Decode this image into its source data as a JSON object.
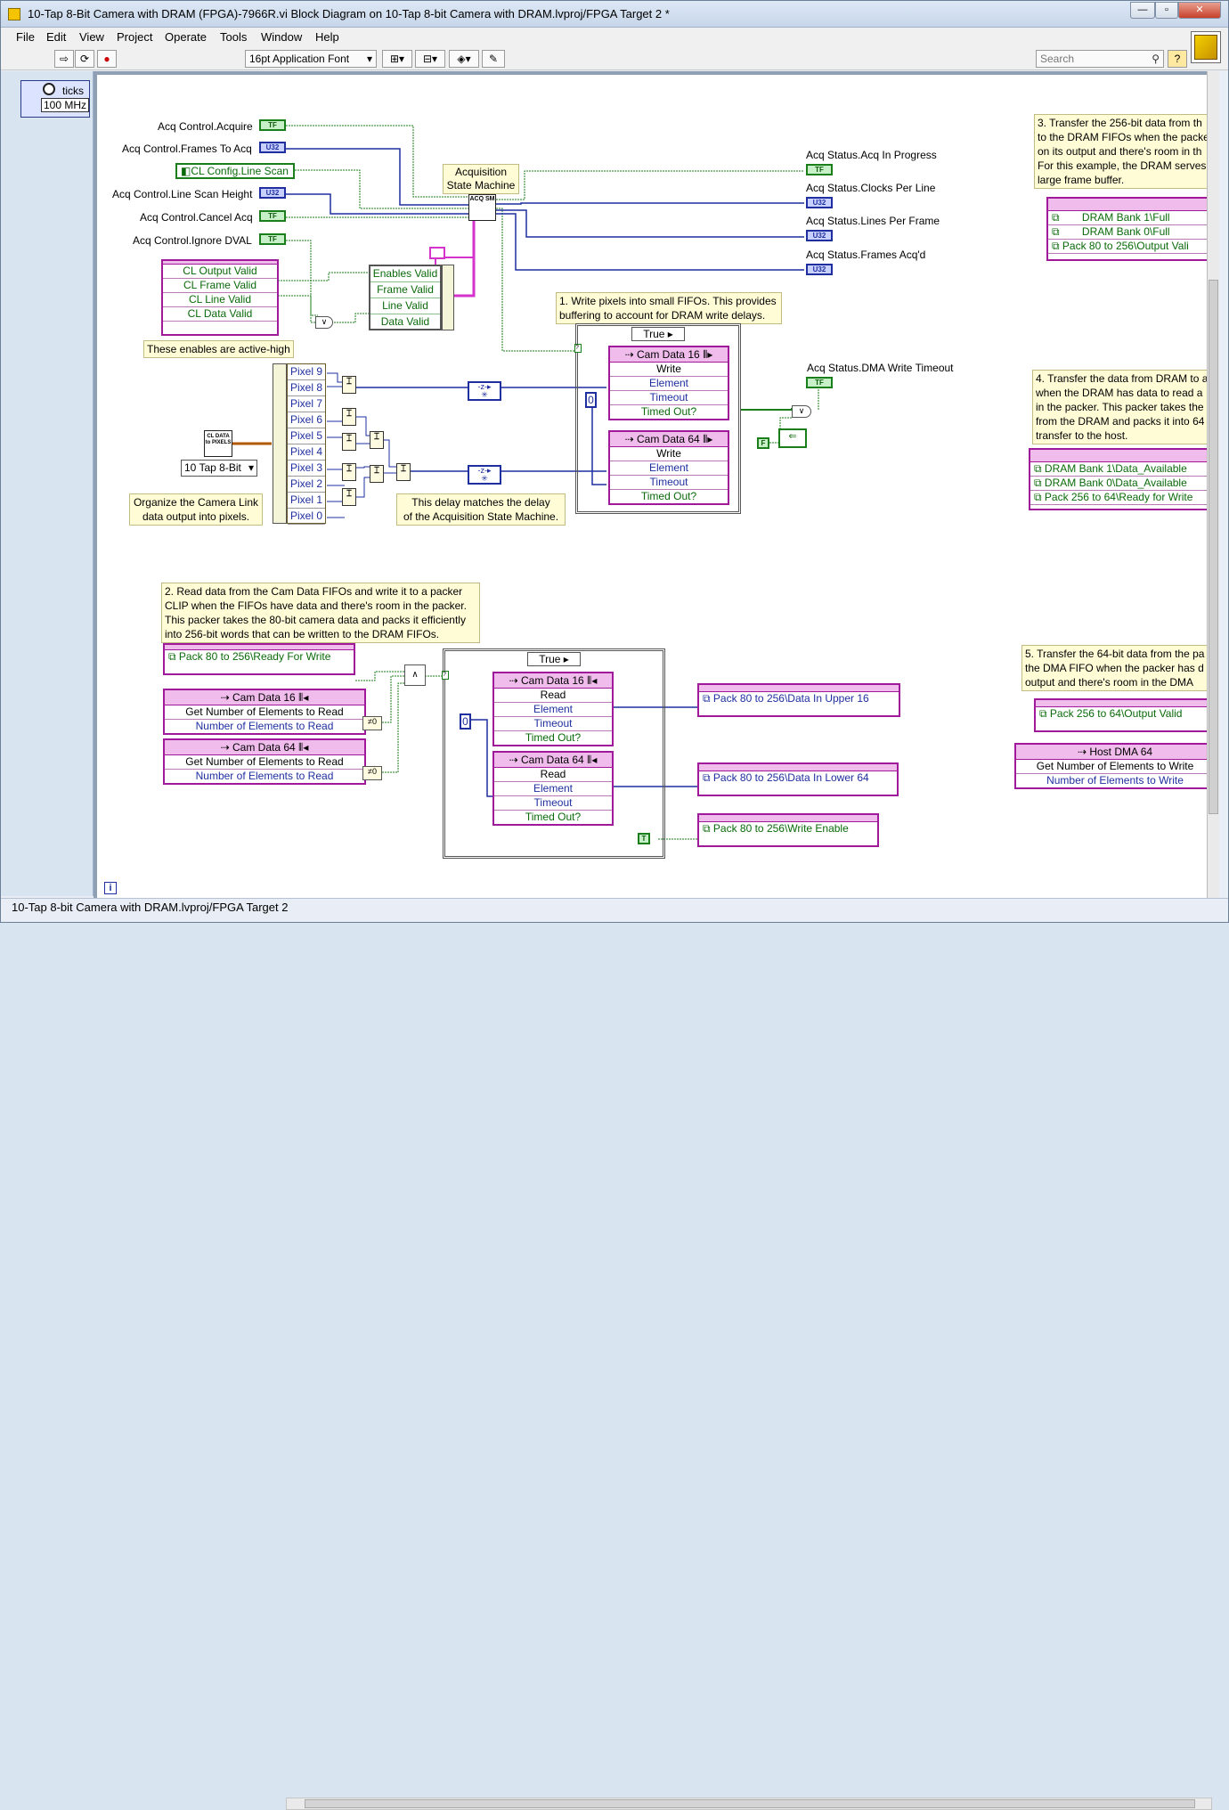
{
  "window": {
    "title": "10-Tap 8-Bit Camera with DRAM (FPGA)-7966R.vi Block Diagram on 10-Tap 8-bit Camera with DRAM.lvproj/FPGA Target 2 *",
    "min": "—",
    "max": "▫",
    "close": "✕"
  },
  "menu": [
    "File",
    "Edit",
    "View",
    "Project",
    "Operate",
    "Tools",
    "Window",
    "Help"
  ],
  "toolbar": {
    "font": "16pt Application Font",
    "search_placeholder": "Search",
    "help": "?"
  },
  "left_panel": {
    "ticks_label": "ticks",
    "clock": "100 MHz"
  },
  "status": {
    "path": "10-Tap 8-bit Camera with DRAM.lvproj/FPGA Target 2"
  },
  "diagram": {
    "controls": [
      {
        "label": "Acq Control.Acquire",
        "type": "TF"
      },
      {
        "label": "Acq Control.Frames To Acq",
        "type": "U32"
      },
      {
        "label": "CL Config.Line Scan",
        "type": "TF"
      },
      {
        "label": "Acq Control.Line Scan Height",
        "type": "U32"
      },
      {
        "label": "Acq Control.Cancel Acq",
        "type": "TF"
      },
      {
        "label": "Acq Control.Ignore DVAL",
        "type": "TF"
      }
    ],
    "indicators": [
      {
        "label": "Acq Status.Acq In Progress",
        "type": "TF"
      },
      {
        "label": "Acq Status.Clocks Per Line",
        "type": "U32"
      },
      {
        "label": "Acq Status.Lines Per Frame",
        "type": "U32"
      },
      {
        "label": "Acq Status.Frames Acq'd",
        "type": "U32"
      },
      {
        "label": "Acq Status.DMA Write Timeout",
        "type": "TF"
      }
    ],
    "acq_sm": {
      "caption": "Acquisition\nState Machine",
      "icon": "ACQ SM"
    },
    "cl_nodes": [
      "CL Output Valid",
      "CL Frame Valid",
      "CL Line Valid",
      "CL Data Valid"
    ],
    "enables": [
      "Enables Valid",
      "Frame Valid",
      "Line Valid",
      "Data Valid"
    ],
    "enables_comment": "These enables are active-high",
    "pixels": [
      "Pixel 9",
      "Pixel 8",
      "Pixel 7",
      "Pixel 6",
      "Pixel 5",
      "Pixel 4",
      "Pixel 3",
      "Pixel 2",
      "Pixel 1",
      "Pixel 0"
    ],
    "cl_data_icon": "CL DATA to PIXELS",
    "tap_select": "10 Tap 8-Bit",
    "organize_comment": "Organize the Camera Link\ndata output into pixels.",
    "delay_comment": "This delay matches the delay\nof the Acquisition State Machine.",
    "c1": "1. Write pixels into small FIFOs. This provides\nbuffering to account for DRAM write delays.",
    "case_true": "True",
    "fifo_writes": [
      {
        "name": "Cam Data 16",
        "rows": [
          "Write",
          "Element",
          "Timeout",
          "Timed Out?"
        ]
      },
      {
        "name": "Cam Data 64",
        "rows": [
          "Write",
          "Element",
          "Timeout",
          "Timed Out?"
        ]
      }
    ],
    "zero": "0",
    "false_const": "F",
    "true_const": "T",
    "c2": "2. Read data from the Cam Data FIFOs and write it to a packer\nCLIP when the FIFOs have data and there's room in the packer.\nThis packer takes the 80-bit camera data and packs it efficiently\ninto 256-bit words that can be written to the DRAM FIFOs.",
    "pack_ready": "Pack 80 to 256\\Ready For Write",
    "get_num": [
      {
        "name": "Cam Data 16",
        "rows": [
          "Get Number of Elements to Read",
          "Number of Elements to Read"
        ]
      },
      {
        "name": "Cam Data 64",
        "rows": [
          "Get Number of Elements to Read",
          "Number of Elements to Read"
        ]
      }
    ],
    "fifo_reads": [
      {
        "name": "Cam Data 16",
        "rows": [
          "Read",
          "Element",
          "Timeout",
          "Timed Out?"
        ]
      },
      {
        "name": "Cam Data 64",
        "rows": [
          "Read",
          "Element",
          "Timeout",
          "Timed Out?"
        ]
      }
    ],
    "pack_outputs": [
      "Pack 80 to 256\\Data In Upper 16",
      "Pack 80 to 256\\Data In Lower 64",
      "Pack 80 to 256\\Write Enable"
    ],
    "c3": "3. Transfer the 256-bit data from th\nto the DRAM FIFOs when the packe\non its output and there's room in th\nFor this example, the DRAM serves\nlarge frame buffer.",
    "dram_full": [
      "DRAM Bank 1\\Full",
      "DRAM Bank 0\\Full",
      "Pack 80 to 256\\Output Vali"
    ],
    "c4": "4. Transfer the data from DRAM to a\nwhen the DRAM has data to read a\nin the packer. This packer takes the\nfrom the DRAM and packs it into 64\ntransfer to the host.",
    "dram_avail": [
      "DRAM Bank 1\\Data_Available",
      "DRAM Bank 0\\Data_Available",
      "Pack 256 to 64\\Ready for Write"
    ],
    "c5": "5. Transfer the 64-bit data from the pa\nthe DMA FIFO when the packer has d\noutput and there's room in the DMA",
    "pack64_valid": "Pack 256 to 64\\Output Valid",
    "host_dma": {
      "name": "Host DMA 64",
      "rows": [
        "Get Number of Elements to Write",
        "Number of Elements to Write"
      ]
    }
  }
}
